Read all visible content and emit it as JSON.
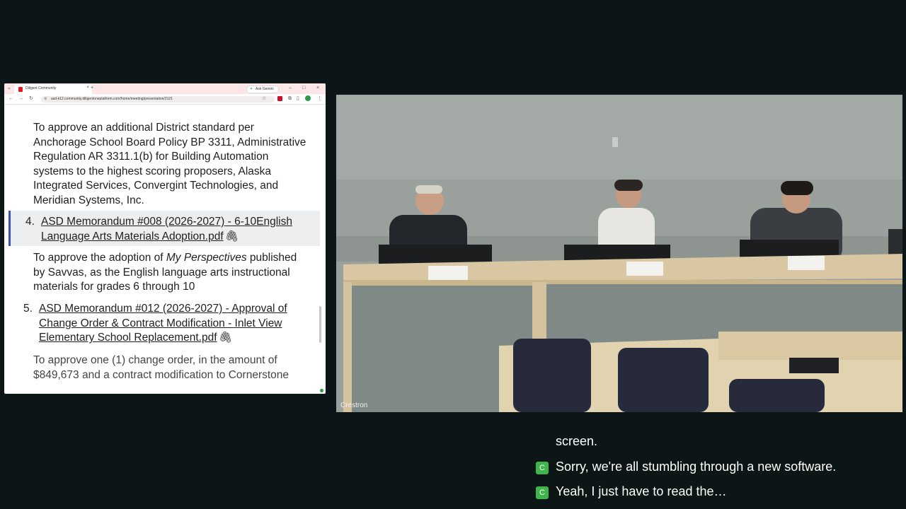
{
  "browser": {
    "tab_title": "Diligent Community",
    "url": "asd-k12.community.diligentoneplatform.com/home/meeting/presentation/2121",
    "gemini_label": "Ask Gemini"
  },
  "document": {
    "intro_lines": [
      "To approve an additional District standard per",
      "Anchorage School Board Policy BP 3311, Administrative",
      "Regulation AR 3311.1(b) for Building Automation",
      "systems to the highest scoring proposers, Alaska",
      "Integrated Services, Convergint Technologies, and",
      "Meridian Systems, Inc."
    ],
    "item4": {
      "number": "4.",
      "link_lines": [
        "ASD Memorandum #008 (2026-2027) - 6-10English",
        "Language Arts Materials Adoption.pdf"
      ],
      "desc_before": "To approve the adoption of ",
      "desc_italic": "My Perspectives",
      "desc_after": " published",
      "desc_lines": [
        "by Savvas, as the English language arts instructional",
        "materials for grades 6 through 10"
      ]
    },
    "item5": {
      "number": "5.",
      "link_lines": [
        "ASD Memorandum #012 (2026-2027) - Approval of",
        "Change Order & Contract Modification - Inlet View",
        "Elementary School Replacement.pdf"
      ],
      "desc_lines": [
        "To approve one (1) change order, in the amount of",
        "$849,673 and a contract modification to Cornerstone"
      ]
    },
    "attachment_icon": "paperclip-icon"
  },
  "video": {
    "source_label": "Crestron"
  },
  "captions": [
    {
      "speaker_badge": "",
      "text": "screen."
    },
    {
      "speaker_badge": "C",
      "text": "Sorry, we're all stumbling through a new software."
    },
    {
      "speaker_badge": "C",
      "text": "Yeah, I just have to read the…"
    }
  ],
  "colors": {
    "page_bg": "#0d1616",
    "link_highlight_bar": "#3b4fb8",
    "caption_badge": "#3fb54a",
    "favicon": "#e31b23"
  }
}
